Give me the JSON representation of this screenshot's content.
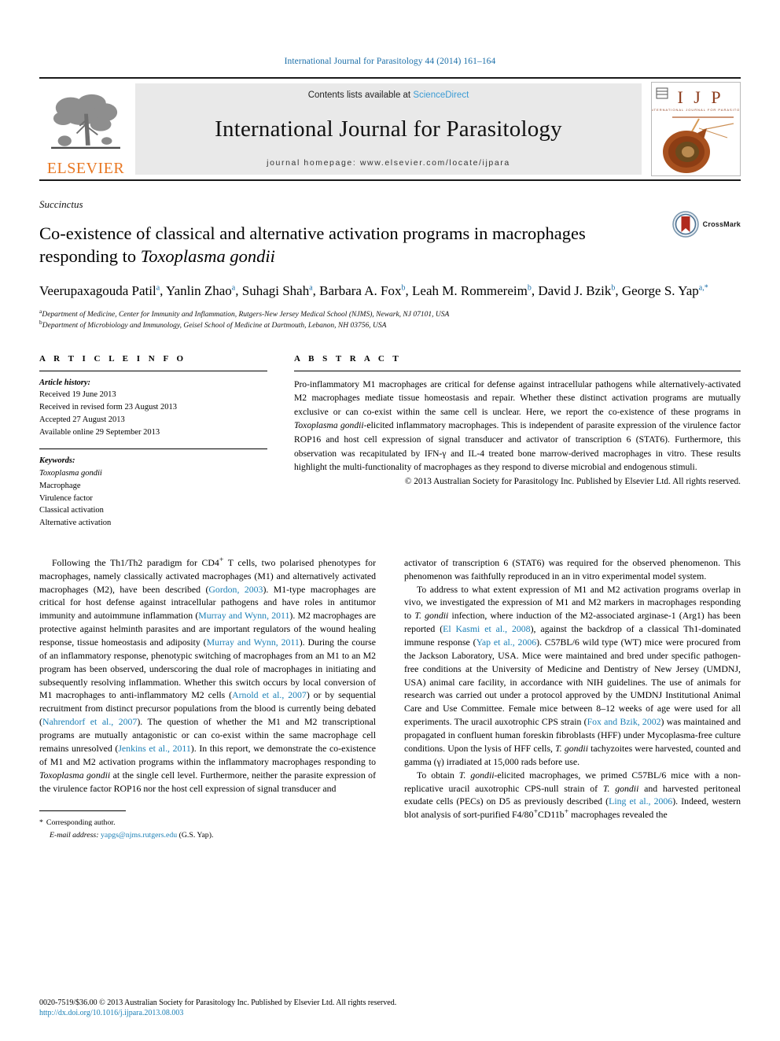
{
  "running_head": "International Journal for Parasitology 44 (2014) 161–164",
  "masthead": {
    "publisher_name": "ELSEVIER",
    "contents_prefix": "Contents lists available at ",
    "contents_link": "ScienceDirect",
    "journal_title": "International Journal for Parasitology",
    "homepage": "journal homepage: www.elsevier.com/locate/ijpara",
    "cover_title": "I J P",
    "cover_subtitle": "INTERNATIONAL JOURNAL FOR PARASITOLOGY"
  },
  "article": {
    "section_label": "Succinctus",
    "title_part1": "Co-existence of classical and alternative activation programs in macrophages responding to ",
    "title_italic": "Toxoplasma gondii",
    "crossmark_label": "CrossMark",
    "authors": [
      {
        "name": "Veerupaxagouda Patil",
        "sup": "a"
      },
      {
        "name": "Yanlin Zhao",
        "sup": "a"
      },
      {
        "name": "Suhagi Shah",
        "sup": "a"
      },
      {
        "name": "Barbara A. Fox",
        "sup": "b"
      },
      {
        "name": "Leah M. Rommereim",
        "sup": "b"
      },
      {
        "name": "David J. Bzik",
        "sup": "b"
      },
      {
        "name": "George S. Yap",
        "sup": "a,*"
      }
    ],
    "affiliations": [
      {
        "marker": "a",
        "text": "Department of Medicine, Center for Immunity and Inflammation, Rutgers-New Jersey Medical School (NJMS), Newark, NJ 07101, USA"
      },
      {
        "marker": "b",
        "text": "Department of Microbiology and Immunology, Geisel School of Medicine at Dartmouth, Lebanon, NH 03756, USA"
      }
    ]
  },
  "article_info": {
    "heading": "A R T I C L E   I N F O",
    "history_label": "Article history:",
    "history": [
      "Received 19 June 2013",
      "Received in revised form 23 August 2013",
      "Accepted 27 August 2013",
      "Available online 29 September 2013"
    ],
    "keywords_label": "Keywords:",
    "keywords": [
      "Toxoplasma gondii",
      "Macrophage",
      "Virulence factor",
      "Classical activation",
      "Alternative activation"
    ]
  },
  "abstract": {
    "heading": "A B S T R A C T",
    "part1": "Pro-inflammatory M1 macrophages are critical for defense against intracellular pathogens while alternatively-activated M2 macrophages mediate tissue homeostasis and repair. Whether these distinct activation programs are mutually exclusive or can co-exist within the same cell is unclear. Here, we report the co-existence of these programs in ",
    "italic1": "Toxoplasma gondii",
    "part2": "-elicited inflammatory macrophages. This is independent of parasite expression of the virulence factor ROP16 and host cell expression of signal transducer and activator of transcription 6 (STAT6). Furthermore, this observation was recapitulated by IFN-γ and IL-4 treated bone marrow-derived macrophages in vitro. These results highlight the multi-functionality of macrophages as they respond to diverse microbial and endogenous stimuli.",
    "copyright": "© 2013 Australian Society for Parasitology Inc. Published by Elsevier Ltd. All rights reserved."
  },
  "body": {
    "left": {
      "p1_a": "Following the Th1/Th2 paradigm for CD4",
      "p1_sup": "+",
      "p1_b": " T cells, two polarised phenotypes for macrophages, namely classically activated macrophages (M1) and alternatively activated macrophages (M2), have been described (",
      "ref1": "Gordon, 2003",
      "p1_c": "). M1-type macrophages are critical for host defense against intracellular pathogens and have roles in antitumor immunity and autoimmune inflammation (",
      "ref2": "Murray and Wynn, 2011",
      "p1_d": "). M2 macrophages are protective against helminth parasites and are important regulators of the wound healing response, tissue homeostasis and adiposity (",
      "ref3": "Murray and Wynn, 2011",
      "p1_e": "). During the course of an inflammatory response, phenotypic switching of macrophages from an M1 to an M2 program has been observed, underscoring the dual role of macrophages in initiating and subsequently resolving inflammation. Whether this switch occurs by local conversion of M1 macrophages to anti-inflammatory M2 cells (",
      "ref4": "Arnold et al., 2007",
      "p1_f": ") or by sequential recruitment from distinct precursor populations from the blood is currently being debated (",
      "ref5": "Nahrendorf et al., 2007",
      "p1_g": "). The question of whether the M1 and M2 transcriptional programs are mutually antagonistic or can co-exist within the same macrophage cell remains unresolved (",
      "ref6": "Jenkins et al., 2011",
      "p1_h": "). In this report, we demonstrate the co-existence of M1 and M2 activation programs within the inflammatory macrophages responding to ",
      "p1_italic": "Toxoplasma gondii",
      "p1_i": " at the single cell level. Furthermore, neither the parasite expression of the virulence factor ROP16 nor the host cell expression of signal transducer and"
    },
    "right": {
      "p1": "activator of transcription 6 (STAT6) was required for the observed phenomenon. This phenomenon was faithfully reproduced in an in vitro experimental model system.",
      "p2_a": "To address to what extent expression of M1 and M2 activation programs overlap in vivo, we investigated the expression of M1 and M2 markers in macrophages responding to ",
      "p2_it1": "T. gondii",
      "p2_b": " infection, where induction of the M2-associated arginase-1 (Arg1) has been reported (",
      "ref1": "El Kasmi et al., 2008",
      "p2_c": "), against the backdrop of a classical Th1-dominated immune response (",
      "ref2": "Yap et al., 2006",
      "p2_d": "). C57BL/6 wild type (WT) mice were procured from the Jackson Laboratory, USA. Mice were maintained and bred under specific pathogen-free conditions at the University of Medicine and Dentistry of New Jersey (UMDNJ, USA) animal care facility, in accordance with NIH guidelines. The use of animals for research was carried out under a protocol approved by the UMDNJ Institutional Animal Care and Use Committee. Female mice between 8–12 weeks of age were used for all experiments. The uracil auxotrophic CPS strain (",
      "ref3": "Fox and Bzik, 2002",
      "p2_e": ") was maintained and propagated in confluent human foreskin fibroblasts (HFF) under Mycoplasma-free culture conditions. Upon the lysis of HFF cells, ",
      "p2_it2": "T. gondii",
      "p2_f": " tachyzoites were harvested, counted and gamma (γ) irradiated at 15,000 rads before use.",
      "p3_a": "To obtain ",
      "p3_it1": "T. gondii",
      "p3_b": "-elicited macrophages, we primed C57BL/6 mice with a non-replicative uracil auxotrophic CPS-null strain of ",
      "p3_it2": "T. gondii",
      "p3_c": " and harvested peritoneal exudate cells (PECs) on D5 as previously described (",
      "ref4": "Ling et al., 2006",
      "p3_d": "). Indeed, western blot analysis of sort-purified F4/80",
      "p3_sup1": "+",
      "p3_e": "CD11b",
      "p3_sup2": "+",
      "p3_f": " macrophages revealed the"
    }
  },
  "corresponding": {
    "star": "*",
    "label": "Corresponding author.",
    "email_label": "E-mail address:",
    "email": "yapgs@njms.rutgers.edu",
    "email_suffix": " (G.S. Yap)."
  },
  "footer": {
    "issn_line": "0020-7519/$36.00 © 2013 Australian Society for Parasitology Inc. Published by Elsevier Ltd. All rights reserved.",
    "doi": "http://dx.doi.org/10.1016/j.ijpara.2013.08.003"
  },
  "colors": {
    "link": "#1a7fb5",
    "runhead": "#1a6ea8",
    "elsevier_orange": "#e87722",
    "sciencedirect": "#3a9bd4"
  }
}
